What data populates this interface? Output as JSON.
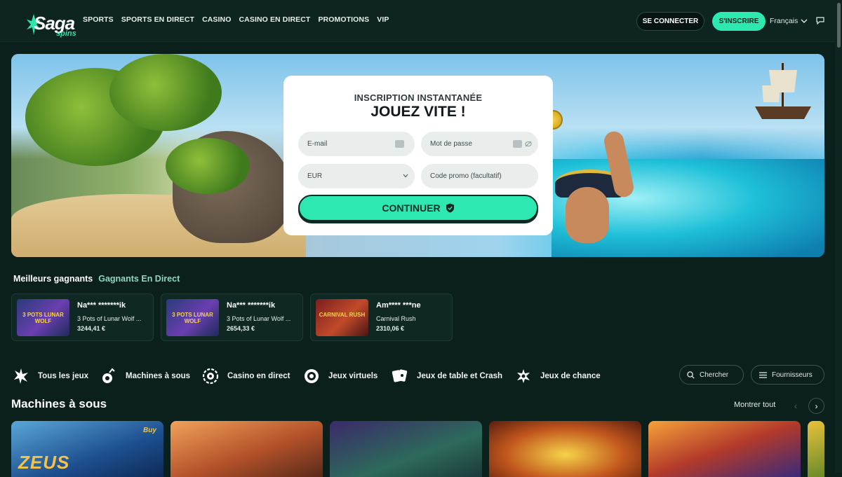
{
  "header": {
    "logo_text": "Saga",
    "logo_sub": "spins",
    "nav": [
      "SPORTS",
      "SPORTS EN DIRECT",
      "CASINO",
      "CASINO EN DIRECT",
      "PROMOTIONS",
      "VIP"
    ],
    "login_label": "SE CONNECTER",
    "signup_label": "S'INSCRIRE",
    "language": "Français",
    "colors": {
      "accent": "#2de8b0",
      "background": "#0b1f1b"
    }
  },
  "hero_form": {
    "kicker": "INSCRIPTION INSTANTANÉE",
    "title": "JOUEZ VITE !",
    "email_placeholder": "E-mail",
    "password_placeholder": "Mot de passe",
    "currency_value": "EUR",
    "promo_placeholder": "Code promo (facultatif)",
    "continue_label": "CONTINUER"
  },
  "winners": {
    "tab_best": "Meilleurs gagnants",
    "tab_live": "Gagnants En Direct",
    "items": [
      {
        "name": "Na*** *******ik",
        "game": "3 Pots of Lunar Wolf ...",
        "amount": "3244,41 €",
        "thumb": "3 POTS LUNAR WOLF"
      },
      {
        "name": "Na*** *******ik",
        "game": "3 Pots of Lunar Wolf ...",
        "amount": "2654,33 €",
        "thumb": "3 POTS LUNAR WOLF"
      },
      {
        "name": "Am**** ***ne",
        "game": "Carnival Rush",
        "amount": "2310,06 €",
        "thumb": "CARNIVAL RUSH"
      }
    ]
  },
  "categories": [
    {
      "label": "Tous les jeux",
      "icon": "all-games-icon"
    },
    {
      "label": "Machines à sous",
      "icon": "slot-machine-icon"
    },
    {
      "label": "Casino en direct",
      "icon": "live-casino-icon"
    },
    {
      "label": "Jeux virtuels",
      "icon": "virtual-games-icon"
    },
    {
      "label": "Jeux de table et Crash",
      "icon": "table-games-icon"
    },
    {
      "label": "Jeux de chance",
      "icon": "lottery-icon"
    }
  ],
  "search_label": "Chercher",
  "providers_label": "Fournisseurs",
  "section": {
    "title": "Machines à sous",
    "show_all": "Montrer tout"
  },
  "games": [
    {
      "title": "ZEUS",
      "badge": "Buy"
    },
    {
      "title": ""
    },
    {
      "title": ""
    },
    {
      "title": ""
    },
    {
      "title": ""
    }
  ]
}
